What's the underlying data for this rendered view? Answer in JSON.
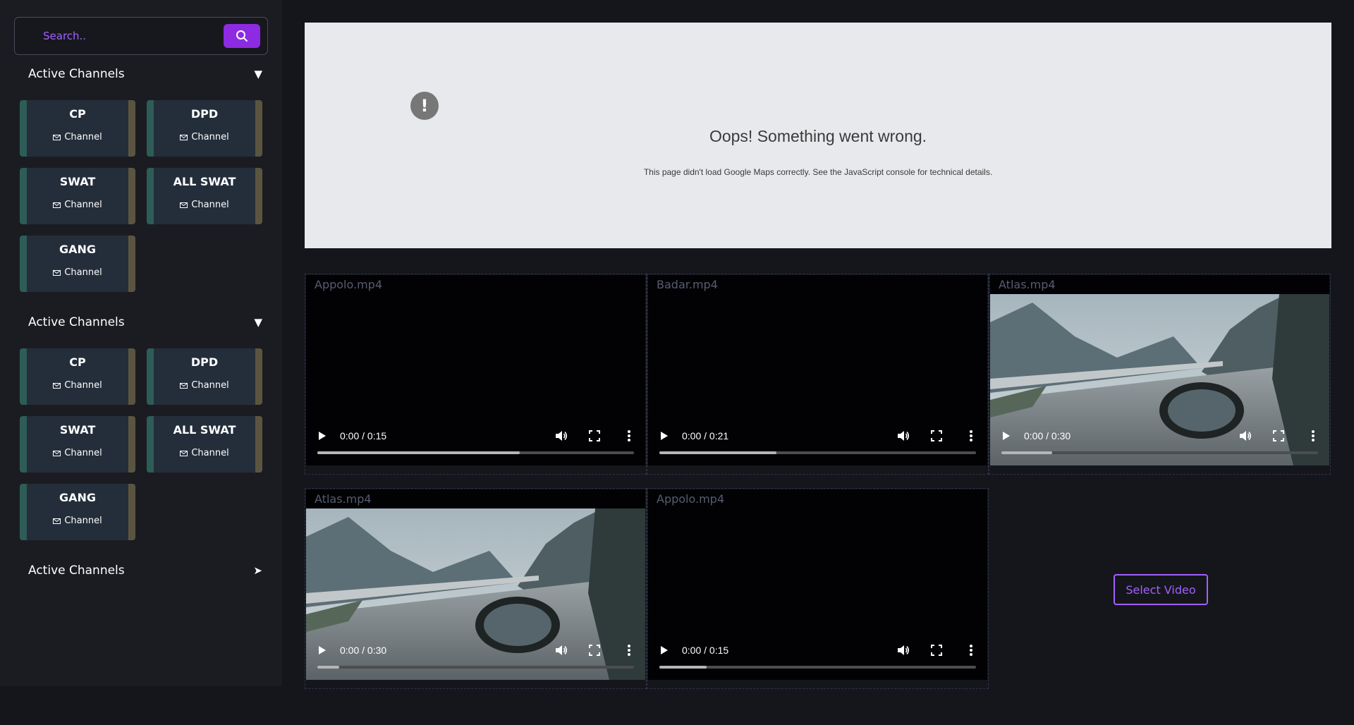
{
  "sidebar": {
    "search": {
      "placeholder": "Search.."
    },
    "sections": [
      {
        "title": "Active Channels",
        "caret": "▼",
        "channels": [
          {
            "name": "CP",
            "label": "Channel"
          },
          {
            "name": "DPD",
            "label": "Channel"
          },
          {
            "name": "SWAT",
            "label": "Channel"
          },
          {
            "name": "ALL SWAT",
            "label": "Channel"
          },
          {
            "name": "GANG",
            "label": "Channel"
          }
        ]
      },
      {
        "title": "Active Channels",
        "caret": "▼",
        "channels": [
          {
            "name": "CP",
            "label": "Channel"
          },
          {
            "name": "DPD",
            "label": "Channel"
          },
          {
            "name": "SWAT",
            "label": "Channel"
          },
          {
            "name": "ALL SWAT",
            "label": "Channel"
          },
          {
            "name": "GANG",
            "label": "Channel"
          }
        ]
      },
      {
        "title": "Active Channels",
        "caret": "➤",
        "channels": []
      }
    ]
  },
  "map": {
    "alert_glyph": "!",
    "title": "Oops! Something went wrong.",
    "message": "This page didn't load Google Maps correctly. See the JavaScript console for technical details."
  },
  "videos": [
    {
      "filename": "Appolo.mp4",
      "time": "0:00 / 0:15",
      "progress": 0.64,
      "has_frame": false
    },
    {
      "filename": "Badar.mp4",
      "time": "0:00 / 0:21",
      "progress": 0.37,
      "has_frame": false
    },
    {
      "filename": "Atlas.mp4",
      "time": "0:00 / 0:30",
      "progress": 0.16,
      "has_frame": true
    },
    {
      "filename": "Atlas.mp4",
      "time": "0:00 / 0:30",
      "progress": 0.07,
      "has_frame": true
    },
    {
      "filename": "Appolo.mp4",
      "time": "0:00 / 0:15",
      "progress": 0.15,
      "has_frame": false
    }
  ],
  "select_video": {
    "label": "Select Video"
  },
  "colors": {
    "accent": "#8c2be2",
    "accent_text": "#a260ff",
    "card_bg": "#242e3b",
    "card_left": "#2e5c57",
    "card_right": "#5b5540"
  },
  "icons": [
    "search-icon",
    "chevron-down-icon",
    "chevron-right-icon",
    "mail-icon",
    "alert-icon",
    "play-icon",
    "volume-icon",
    "fullscreen-icon",
    "more-icon"
  ]
}
